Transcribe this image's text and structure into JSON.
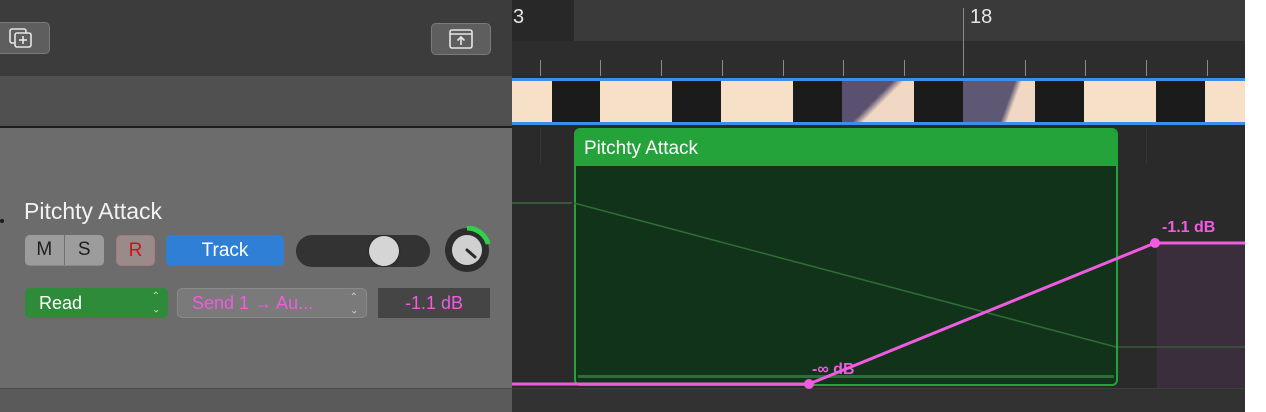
{
  "ruler": {
    "bar_left": "3",
    "bar_right": "18"
  },
  "track": {
    "name": "Pitchty Attack",
    "mute_label": "M",
    "solo_label": "S",
    "record_label": "R",
    "track_mode_label": "Track",
    "automation_mode": "Read",
    "automation_param": "Send 1 → Au...",
    "automation_value": "-1.1 dB",
    "volume_level_fraction": 0.85,
    "pan_level_fraction": 0.2
  },
  "region": {
    "name": "Pitchty Attack"
  },
  "automation": {
    "point_start_label": "-∞ dB",
    "point_end_label": "-1.1 dB"
  },
  "colors": {
    "automation_line": "#f05bdf",
    "region_green": "#23a33a",
    "read_green": "#2e8b3a",
    "track_blue": "#2f7fd6",
    "video_strip_border": "#3b8fe8"
  },
  "icons": {
    "add_track": "plus-square-icon",
    "catch_playhead": "upload-square-icon"
  }
}
